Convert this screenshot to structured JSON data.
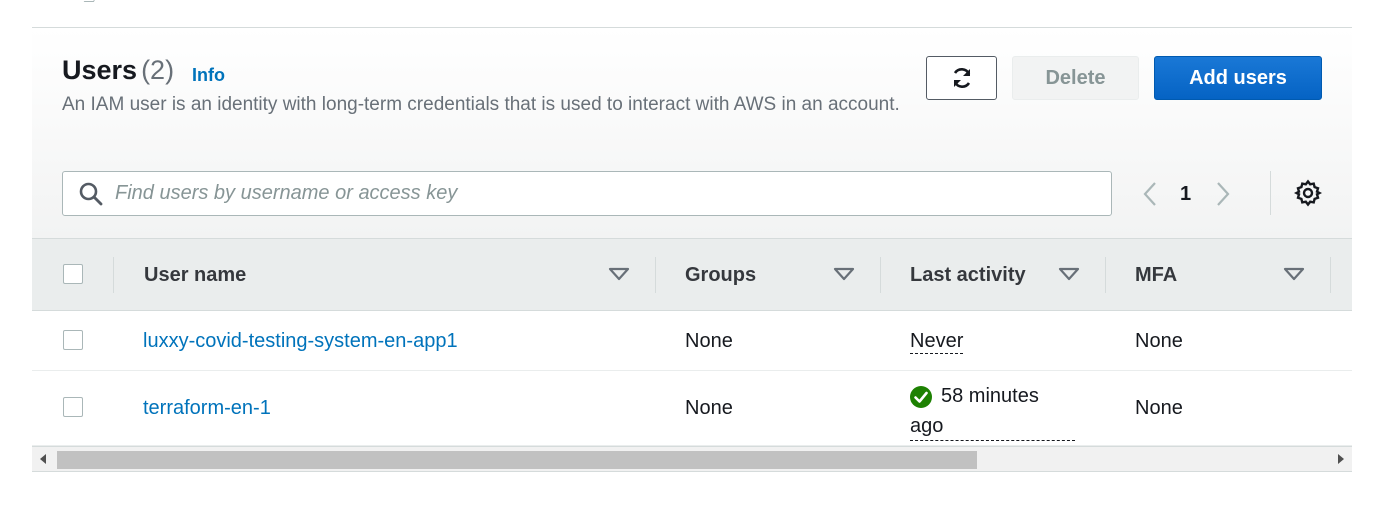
{
  "header": {
    "title": "Users",
    "count": "(2)",
    "info": "Info",
    "description": "An IAM user is an identity with long-term credentials that is used to interact with AWS in an account."
  },
  "actions": {
    "refresh_icon": "refresh-icon",
    "delete_label": "Delete",
    "add_label": "Add users"
  },
  "search": {
    "placeholder": "Find users by username or access key",
    "value": ""
  },
  "pagination": {
    "current_page": "1"
  },
  "table": {
    "columns": [
      "User name",
      "Groups",
      "Last activity",
      "MFA"
    ],
    "rows": [
      {
        "username": "luxxy-covid-testing-system-en-app1",
        "groups": "None",
        "last_activity": "Never",
        "mfa": "None"
      },
      {
        "username": "terraform-en-1",
        "groups": "None",
        "last_activity_line1": "58 minutes",
        "last_activity_line2": "ago",
        "mfa": "None"
      }
    ]
  },
  "colors": {
    "primary": "#0a6ed1",
    "link": "#0073bb",
    "success": "#1d8102"
  }
}
